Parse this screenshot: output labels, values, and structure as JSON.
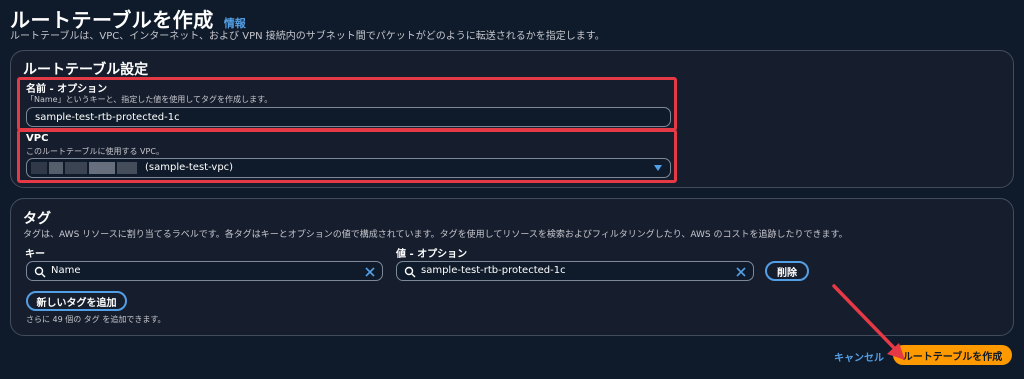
{
  "header": {
    "title": "ルートテーブルを作成",
    "info_link": "情報",
    "description": "ルートテーブルは、VPC、インターネット、および VPN 接続内のサブネット間でパケットがどのように転送されるかを指定します。"
  },
  "settings": {
    "title": "ルートテーブル設定",
    "name_label": "名前 - オプション",
    "name_description": "「Name」というキーと、指定した値を使用してタグを作成します。",
    "name_value": "sample-test-rtb-protected-1c",
    "vpc_label": "VPC",
    "vpc_description": "このルートテーブルに使用する VPC。",
    "vpc_value": "(sample-test-vpc)"
  },
  "tags": {
    "title": "タグ",
    "description": "タグは、AWS リソースに割り当てるラベルです。各タグはキーとオプションの値で構成されています。タグを使用してリソースを検索およびフィルタリングしたり、AWS のコストを追跡したりできます。",
    "key_header": "キー",
    "value_header": "値 - オプション",
    "key_value": "Name",
    "value_value": "sample-test-rtb-protected-1c",
    "remove_label": "削除",
    "add_label": "新しいタグを追加",
    "remaining_note": "さらに 49 個の タグ を追加できます。"
  },
  "footer": {
    "cancel_label": "キャンセル",
    "create_label": "ルートテーブルを作成"
  },
  "colors": {
    "background": "#0f1b2a",
    "panel": "#161e2d",
    "accent_blue": "#539fe5",
    "primary_orange": "#ff9900",
    "highlight_red": "#e63946"
  }
}
